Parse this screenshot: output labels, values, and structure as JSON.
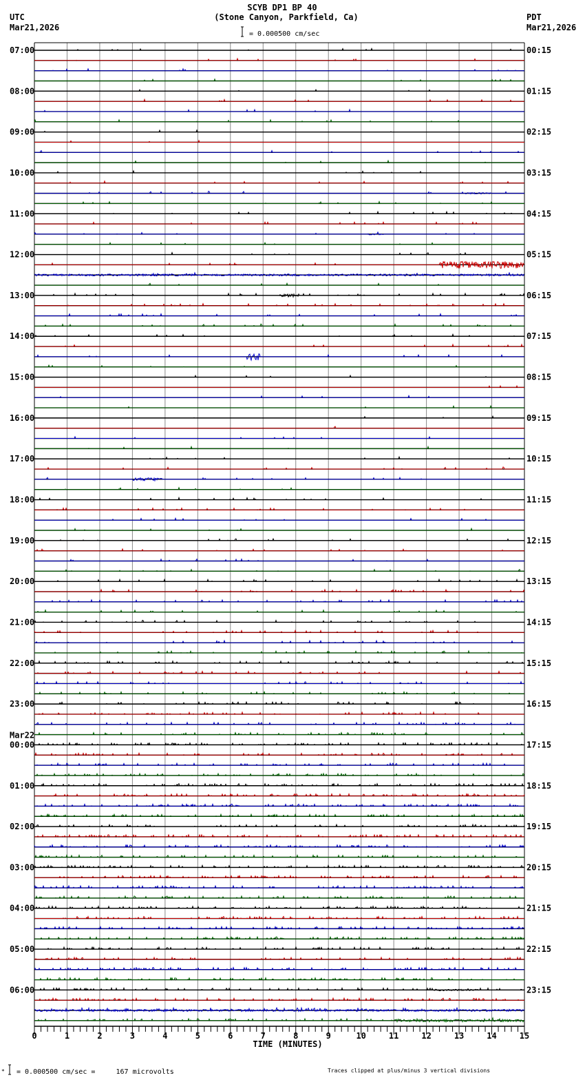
{
  "header": {
    "title": "SCYB DP1 BP 40",
    "subtitle": "(Stone Canyon, Parkfield, Ca)",
    "left_tz": "UTC",
    "left_date": "Mar21,2026",
    "right_tz": "PDT",
    "right_date": "Mar21,2026",
    "scale_text": "= 0.000500 cm/sec"
  },
  "footer": {
    "scale_text": "= 0.000500 cm/sec =     167 microvolts",
    "clip_note": "Traces clipped at plus/minus 3 vertical divisions"
  },
  "chart_data": {
    "type": "line",
    "title": "SCYB DP1 BP 40",
    "xlabel": "TIME (MINUTES)",
    "xlim": [
      0,
      15
    ],
    "x_ticks": [
      "0",
      "1",
      "2",
      "3",
      "4",
      "5",
      "6",
      "7",
      "8",
      "9",
      "10",
      "11",
      "12",
      "13",
      "14",
      "15"
    ],
    "minor_tick_step": 0.2,
    "traces_per_hour": 4,
    "trace_count": 96,
    "trace_colors": [
      "#000000",
      "#cc0000",
      "#0000cc",
      "#006600"
    ],
    "left_labels": [
      "07:00",
      "08:00",
      "09:00",
      "10:00",
      "11:00",
      "12:00",
      "13:00",
      "14:00",
      "15:00",
      "16:00",
      "17:00",
      "18:00",
      "19:00",
      "20:00",
      "21:00",
      "22:00",
      "23:00",
      "00:00",
      "01:00",
      "02:00",
      "03:00",
      "04:00",
      "05:00",
      "06:00"
    ],
    "date_change_label": "Mar22",
    "right_labels": [
      "00:15",
      "01:15",
      "02:15",
      "03:15",
      "04:15",
      "05:15",
      "06:15",
      "07:15",
      "08:15",
      "09:15",
      "10:15",
      "11:15",
      "12:15",
      "13:15",
      "14:15",
      "15:15",
      "16:15",
      "17:15",
      "18:15",
      "19:15",
      "20:15",
      "21:15",
      "22:15",
      "23:15"
    ],
    "events": [
      {
        "trace": 21,
        "start_min": 12.4,
        "end_min": 15.0,
        "amplitude": 0.35
      },
      {
        "trace": 22,
        "start_min": 0.0,
        "end_min": 15.0,
        "amplitude": 0.1
      },
      {
        "trace": 24,
        "start_min": 7.5,
        "end_min": 8.1,
        "amplitude": 0.15
      },
      {
        "trace": 30,
        "start_min": 6.5,
        "end_min": 6.9,
        "amplitude": 0.35
      },
      {
        "trace": 42,
        "start_min": 3.0,
        "end_min": 3.9,
        "amplitude": 0.15
      },
      {
        "trace": 14,
        "start_min": 13.2,
        "end_min": 14.0,
        "amplitude": 0.07
      },
      {
        "trace": 18,
        "start_min": 10.2,
        "end_min": 10.7,
        "amplitude": 0.07
      },
      {
        "trace": 94,
        "start_min": 0.0,
        "end_min": 15.0,
        "amplitude": 0.1
      },
      {
        "trace": 95,
        "start_min": 11.0,
        "end_min": 15.0,
        "amplitude": 0.12
      },
      {
        "trace": 92,
        "start_min": 12.2,
        "end_min": 13.6,
        "amplitude": 0.08
      }
    ],
    "spike_density_by_hour": [
      0.3,
      0.3,
      0.3,
      0.4,
      0.5,
      0.6,
      0.8,
      0.4,
      0.3,
      0.3,
      0.4,
      0.6,
      0.8,
      1,
      1.2,
      1.6,
      2,
      3,
      4,
      4,
      4,
      4,
      4,
      4
    ]
  }
}
